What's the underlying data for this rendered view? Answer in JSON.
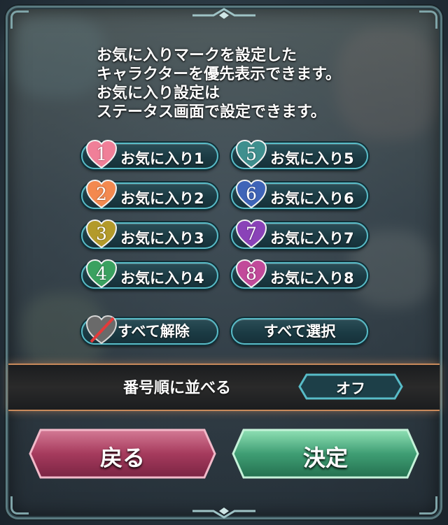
{
  "dialog": {
    "info_lines": [
      "お気に入りマークを設定した",
      "キャラクターを優先表示できます。",
      "お気に入り設定は",
      "ステータス画面で設定できます。"
    ]
  },
  "favorites": [
    {
      "num": "1",
      "label": "お気に入り1",
      "color": "#f07f98"
    },
    {
      "num": "2",
      "label": "お気に入り2",
      "color": "#f3894f"
    },
    {
      "num": "3",
      "label": "お気に入り3",
      "color": "#b39a2a"
    },
    {
      "num": "4",
      "label": "お気に入り4",
      "color": "#3aa160"
    },
    {
      "num": "5",
      "label": "お気に入り5",
      "color": "#3f8f8e"
    },
    {
      "num": "6",
      "label": "お気に入り6",
      "color": "#3f64b8"
    },
    {
      "num": "7",
      "label": "お気に入り7",
      "color": "#8a42b8"
    },
    {
      "num": "8",
      "label": "お気に入り8",
      "color": "#c24a9a"
    }
  ],
  "actions": {
    "clear_all": "すべて解除",
    "select_all": "すべて選択"
  },
  "sort": {
    "label": "番号順に並べる",
    "value": "オフ"
  },
  "footer": {
    "back": "戻る",
    "confirm": "決定"
  },
  "colors": {
    "frame": "#5a7a80",
    "button_border": "#58bcc8",
    "back_button": "#c85a7a",
    "confirm_button": "#4fb88a"
  }
}
